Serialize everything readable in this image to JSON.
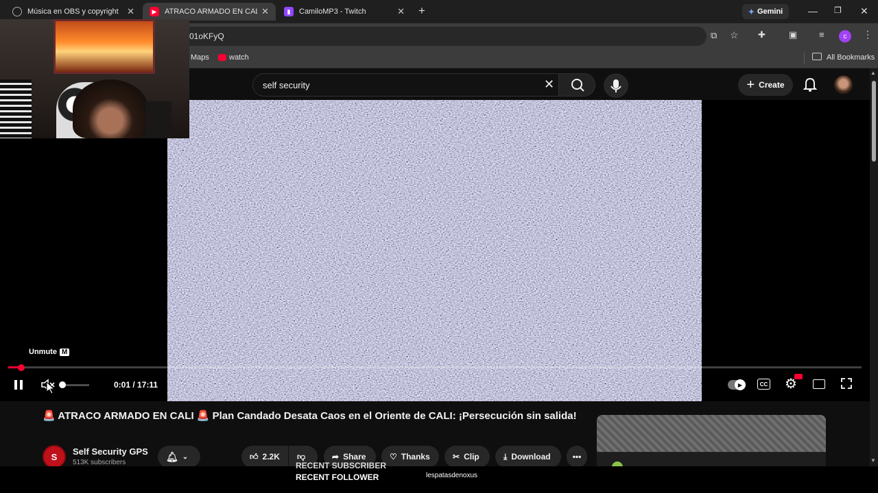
{
  "browser": {
    "tabs": [
      {
        "title": "Música en OBS y copyright",
        "active": false
      },
      {
        "title": "ATRACO ARMADO EN CALI",
        "active": true
      },
      {
        "title": "CamiloMP3 - Twitch",
        "active": false
      }
    ],
    "gemini_label": "Gemini",
    "url_fragment": "01oKFyQ",
    "bookmarks": [
      "Maps",
      "watch"
    ],
    "all_bookmarks_label": "All Bookmarks",
    "profile_initial": "c"
  },
  "youtube": {
    "search": {
      "value": "self security"
    },
    "create_label": "Create"
  },
  "player": {
    "tooltip": {
      "label": "Unmute",
      "shortcut": "M"
    },
    "time": "0:01 / 17:11",
    "progress_fraction": 0.015,
    "volume_fraction": 0.0
  },
  "video": {
    "title": "🚨 ATRACO ARMADO EN CALI 🚨 Plan Candado Desata Caos en el Oriente de CALI: ¡Persecución sin salida!",
    "channel": {
      "name": "Self Security GPS",
      "subscribers": "513K subscribers"
    },
    "actions": {
      "likes": "2.2K",
      "share": "Share",
      "thanks": "Thanks",
      "clip": "Clip",
      "download": "Download"
    }
  },
  "overlay": {
    "recent_subscriber": "RECENT SUBSCRIBER",
    "recent_follower": "RECENT FOLLOWER",
    "follower_name": "lespatasdenoxus"
  },
  "colors": {
    "accent_red": "#ff0033",
    "twitch": "#9146ff",
    "profile": "#a142f4"
  }
}
